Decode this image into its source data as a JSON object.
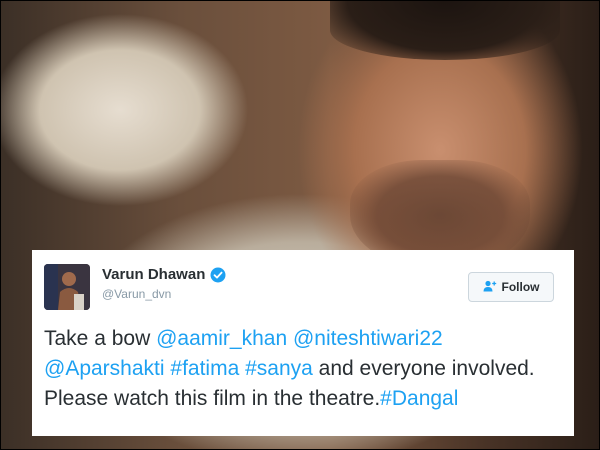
{
  "tweet": {
    "display_name": "Varun Dhawan",
    "handle": "@Varun_dvn",
    "verified": true,
    "follow_label": "Follow",
    "text_parts": [
      {
        "text": "Take a bow ",
        "link": false
      },
      {
        "text": "@aamir_khan",
        "link": true
      },
      {
        "text": " ",
        "link": false
      },
      {
        "text": "@niteshtiwari22",
        "link": true
      },
      {
        "text": " ",
        "link": false
      },
      {
        "text": "@Aparshakti",
        "link": true
      },
      {
        "text": " ",
        "link": false
      },
      {
        "text": "#fatima",
        "link": true
      },
      {
        "text": " ",
        "link": false
      },
      {
        "text": "#sanya",
        "link": true
      },
      {
        "text": " and everyone involved. Please watch this film in the theatre.",
        "link": false
      },
      {
        "text": "#Dangal",
        "link": true
      }
    ]
  },
  "icons": {
    "verified": "verified-badge-icon",
    "follow": "add-user-icon"
  },
  "colors": {
    "link": "#1da1f2",
    "text": "#292f33",
    "handle": "#8899a6",
    "card_background": "#ffffff"
  }
}
